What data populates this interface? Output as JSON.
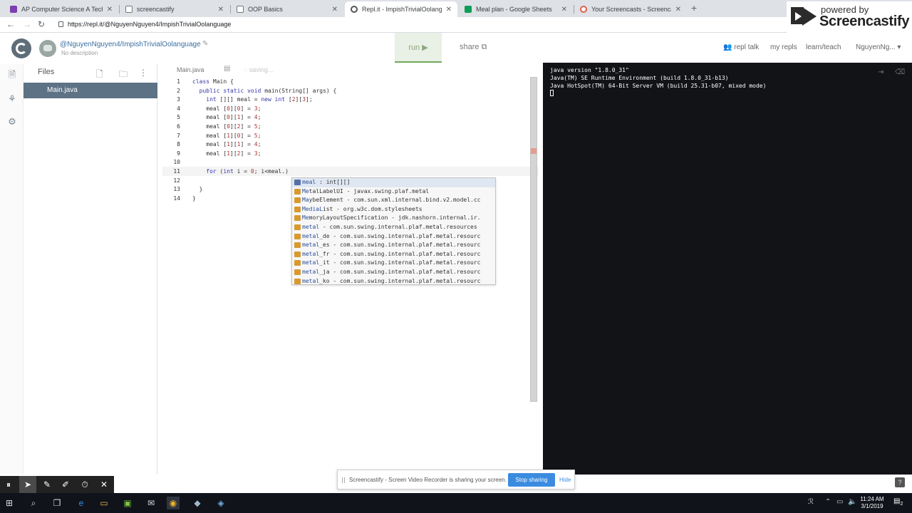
{
  "browser": {
    "tabs": [
      {
        "label": "AP Computer Science A Technol",
        "color": "#7b3fb0"
      },
      {
        "label": "screencastify",
        "color": "#777777"
      },
      {
        "label": "OOP Basics",
        "color": "#777777"
      },
      {
        "label": "Repl.it - ImpishTrivialOolanguage",
        "color": "#555555"
      },
      {
        "label": "Meal plan - Google Sheets",
        "color": "#0f9d58"
      },
      {
        "label": "Your Screencasts - Screencastify",
        "color": "#e0604d"
      }
    ],
    "url": "https://repl.it/@NguyenNguyen4/ImpishTrivialOolanguage"
  },
  "brand": {
    "powered": "powered by",
    "name": "Screencastify"
  },
  "repl": {
    "username": "@NguyenNguyen4/ImpishTrivialOolanguage",
    "description": "No description",
    "run_label": "run ▶",
    "share_label": "share",
    "nav": [
      "repl talk",
      "my repls",
      "learn/teach",
      "NguyenNg..."
    ]
  },
  "files": {
    "title": "Files",
    "items": [
      "Main.java"
    ]
  },
  "editor": {
    "tab": "Main.java",
    "status": "saving...",
    "lines": [
      "class Main {",
      "  public static void main(String[] args) {",
      "    int [][] meal = new int [2][3];",
      "    meal [0][0] = 3;",
      "    meal [0][1] = 4;",
      "    meal [0][2] = 5;",
      "    meal [1][0] = 5;",
      "    meal [1][1] = 4;",
      "    meal [1][2] = 3;",
      "",
      "    for (int i = 0; i<meal.)",
      "",
      "  }",
      "}"
    ],
    "current_line": 11
  },
  "autocomplete": {
    "items": [
      {
        "match": "meal",
        "rest": " : int[][]",
        "kind": "var"
      },
      {
        "match": "Me",
        "rest": "talLabelUI - javax.swing.plaf.metal",
        "kind": "cls"
      },
      {
        "match": "Ma",
        "rest": "ybeElement - com.sun.xml.internal.bind.v2.model.cc",
        "kind": "cls"
      },
      {
        "match": "MediaL",
        "rest": "ist - org.w3c.dom.stylesheets",
        "kind": "cls"
      },
      {
        "match": "Me",
        "rest": "moryLayoutSpecification - jdk.nashorn.internal.ir.",
        "kind": "cls"
      },
      {
        "match": "metal",
        "rest": " - com.sun.swing.internal.plaf.metal.resources",
        "kind": "cls"
      },
      {
        "match": "metal",
        "rest": "_de - com.sun.swing.internal.plaf.metal.resourc",
        "kind": "cls"
      },
      {
        "match": "metal",
        "rest": "_es - com.sun.swing.internal.plaf.metal.resourc",
        "kind": "cls"
      },
      {
        "match": "metal",
        "rest": "_fr - com.sun.swing.internal.plaf.metal.resourc",
        "kind": "cls"
      },
      {
        "match": "metal",
        "rest": "_it - com.sun.swing.internal.plaf.metal.resourc",
        "kind": "cls"
      },
      {
        "match": "metal",
        "rest": "_ja - com.sun.swing.internal.plaf.metal.resourc",
        "kind": "cls"
      },
      {
        "match": "metal",
        "rest": "_ko - com.sun.swing.internal.plaf.metal.resourc",
        "kind": "cls"
      }
    ]
  },
  "console": {
    "lines": [
      "java version \"1.8.0_31\"",
      "Java(TM) SE Runtime Environment (build 1.8.0_31-b13)",
      "Java HotSpot(TM) 64-Bit Server VM (build 25.31-b07, mixed mode)"
    ]
  },
  "share_banner": {
    "text": "Screencastify - Screen Video Recorder is sharing your screen.",
    "stop_label": "Stop sharing",
    "hide_label": "Hide"
  },
  "taskbar": {
    "time": "11:24 AM",
    "date": "3/1/2019",
    "notifications": "2"
  },
  "colors": {
    "accent": "#5d7285",
    "run": "#6fa85c",
    "console_bg": "#111317",
    "stop": "#3b8ce0"
  }
}
